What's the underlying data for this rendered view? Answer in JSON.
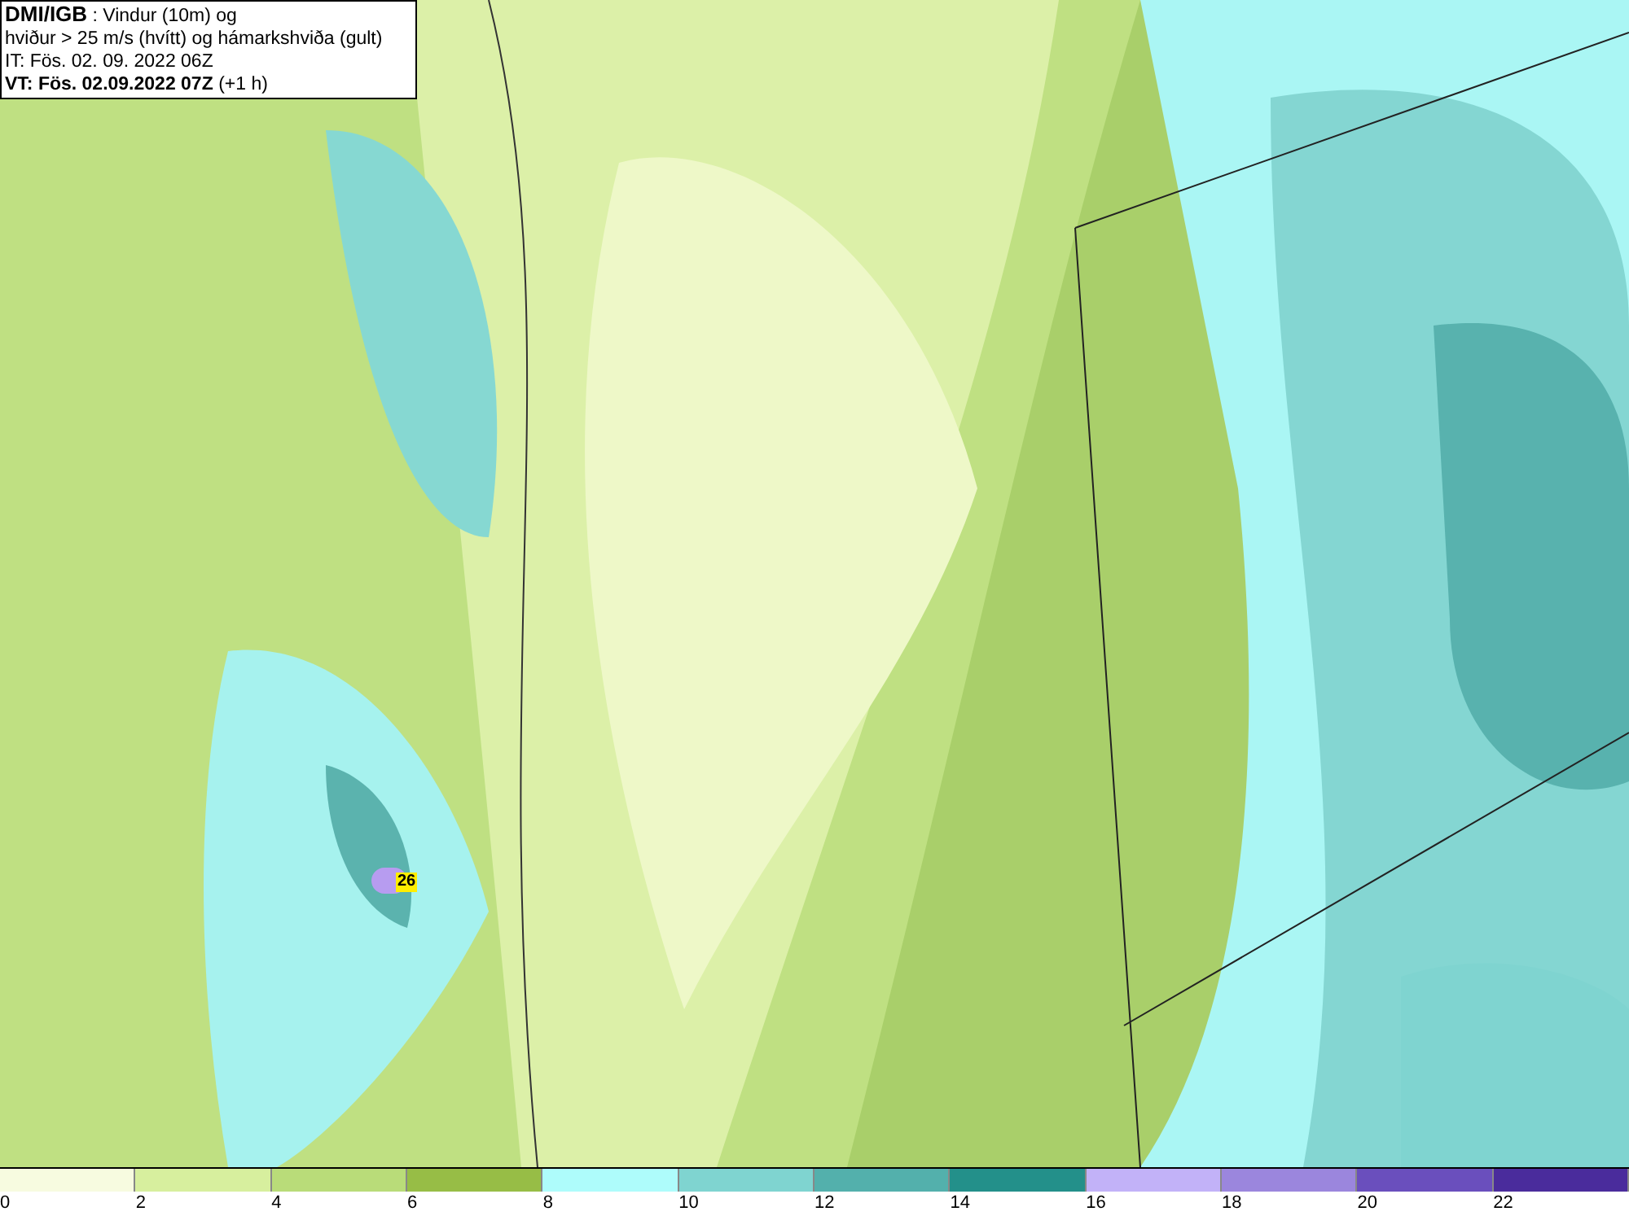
{
  "title_box": {
    "source": "DMI/IGB",
    "lines": [
      " : Vindur (10m) og",
      "hviður > 25 m/s (hvítt) og hámarkshviða (gult)",
      "IT: Fös. 02. 09. 2022 06Z"
    ],
    "valid_time": "VT: Fös. 02.09.2022 07Z",
    "lead": "(+1 h)"
  },
  "gust_label": "26",
  "legend": [
    {
      "label": "0",
      "color": "#f7fbe0"
    },
    {
      "label": "2",
      "color": "#d7ef9e"
    },
    {
      "label": "4",
      "color": "#b9dc79"
    },
    {
      "label": "6",
      "color": "#97bd46"
    },
    {
      "label": "8",
      "color": "#aefcfb"
    },
    {
      "label": "10",
      "color": "#7fd4d0"
    },
    {
      "label": "12",
      "color": "#53b0ac"
    },
    {
      "label": "14",
      "color": "#23908a"
    },
    {
      "label": "16",
      "color": "#c2b2f8"
    },
    {
      "label": "18",
      "color": "#9b86dd"
    },
    {
      "label": "20",
      "color": "#6a4fbd"
    },
    {
      "label": "22",
      "color": "#4a2c9c"
    }
  ]
}
